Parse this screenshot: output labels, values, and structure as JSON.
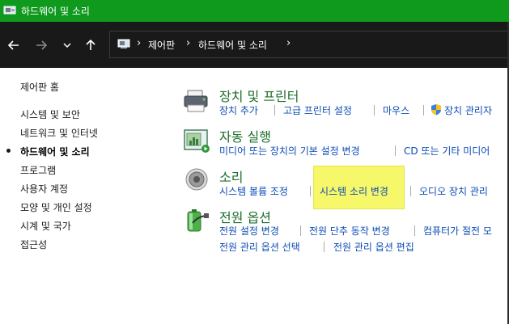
{
  "window": {
    "title": "하드웨어 및 소리"
  },
  "nav": {
    "back": "←",
    "forward": "→",
    "recent": "⌄",
    "up": "↑",
    "breadcrumb": [
      "제어판",
      "하드웨어 및 소리"
    ],
    "separator": "›"
  },
  "sidebar": {
    "items": [
      "제어판 홈",
      "시스템 및 보안",
      "네트워크 및 인터넷",
      "하드웨어 및 소리",
      "프로그램",
      "사용자 계정",
      "모양 및 개인 설정",
      "시계 및 국가",
      "접근성"
    ],
    "current": "하드웨어 및 소리"
  },
  "categories": [
    {
      "title": "장치 및 프린터",
      "icon": "printer-icon",
      "links": [
        [
          "장치 추가",
          "고급 프린터 설정",
          "마우스",
          "장치 관리자"
        ]
      ]
    },
    {
      "title": "자동 실행",
      "icon": "autoplay-icon",
      "links": [
        [
          "미디어 또는 장치의 기본 설정 변경",
          "CD 또는 기타 미디어"
        ]
      ]
    },
    {
      "title": "소리",
      "icon": "speaker-icon",
      "links": [
        [
          "시스템 볼륨 조정",
          "시스템 소리 변경",
          "오디오 장치 관리"
        ]
      ]
    },
    {
      "title": "전원 옵션",
      "icon": "battery-icon",
      "links": [
        [
          "전원 설정 변경",
          "전원 단추 동작 변경",
          "컴퓨터가 절전 모"
        ],
        [
          "전원 관리 옵션 선택",
          "전원 관리 옵션 편집"
        ]
      ]
    }
  ],
  "colors": {
    "titlebar": "#0f9a1e",
    "navbar": "#191919",
    "category_title": "#1e6e2e",
    "link": "#0a4bb5",
    "highlight": "#f7f76a"
  }
}
